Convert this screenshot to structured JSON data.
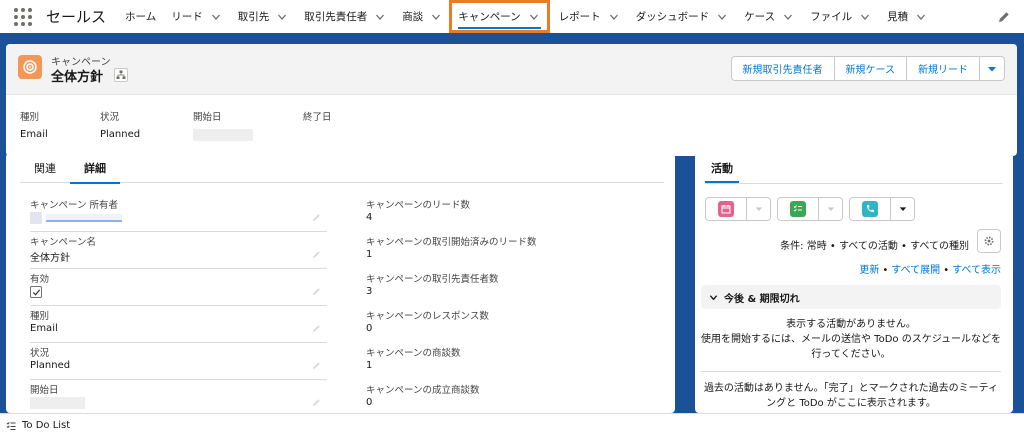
{
  "app": {
    "name": "セールス"
  },
  "nav": {
    "items": [
      {
        "label": "ホーム",
        "has_menu": false
      },
      {
        "label": "リード",
        "has_menu": true
      },
      {
        "label": "取引先",
        "has_menu": true
      },
      {
        "label": "取引先責任者",
        "has_menu": true
      },
      {
        "label": "商談",
        "has_menu": true
      },
      {
        "label": "キャンペーン",
        "has_menu": true,
        "active": true
      },
      {
        "label": "レポート",
        "has_menu": true
      },
      {
        "label": "ダッシュボード",
        "has_menu": true
      },
      {
        "label": "ケース",
        "has_menu": true
      },
      {
        "label": "ファイル",
        "has_menu": true
      },
      {
        "label": "見積",
        "has_menu": true
      }
    ]
  },
  "record": {
    "object_type": "キャンペーン",
    "title": "全体方針",
    "actions": [
      "新規取引先責任者",
      "新規ケース",
      "新規リード"
    ],
    "highlights": [
      {
        "label": "種別",
        "value": "Email"
      },
      {
        "label": "状況",
        "value": "Planned"
      },
      {
        "label": "開始日",
        "value": ""
      },
      {
        "label": "終了日",
        "value": ""
      }
    ]
  },
  "detail": {
    "tabs": [
      "関連",
      "詳細"
    ],
    "active_tab": "詳細",
    "left_fields": [
      {
        "label": "キャンペーン 所有者",
        "value": ""
      },
      {
        "label": "キャンペーン名",
        "value": "全体方針"
      },
      {
        "label": "有効",
        "value": ""
      },
      {
        "label": "種別",
        "value": "Email"
      },
      {
        "label": "状況",
        "value": "Planned"
      },
      {
        "label": "開始日",
        "value": ""
      }
    ],
    "right_fields": [
      {
        "label": "キャンペーンのリード数",
        "value": "4"
      },
      {
        "label": "キャンペーンの取引開始済みのリード数",
        "value": "1"
      },
      {
        "label": "キャンペーンの取引先責任者数",
        "value": "3"
      },
      {
        "label": "キャンペーンのレスポンス数",
        "value": "0"
      },
      {
        "label": "キャンペーンの商談数",
        "value": "1"
      },
      {
        "label": "キャンペーンの成立商談数",
        "value": "0"
      }
    ],
    "active_checked": true
  },
  "activity": {
    "tab": "活動",
    "filter": "条件: 常時 • すべての活動 • すべての種別",
    "links": [
      "更新",
      "すべて展開",
      "すべて表示"
    ],
    "section_title": "今後 & 期限切れ",
    "empty_line1": "表示する活動がありません。",
    "empty_line2": "使用を開始するには、メールの送信や ToDo のスケジュールなどを",
    "empty_line3": "行ってください。",
    "past_line1": "過去の活動はありません。「完了」とマークされた過去のミーティ",
    "past_line2": "ングと ToDo がここに表示されます。"
  },
  "utility": {
    "todo_label": "To Do List"
  },
  "colors": {
    "brand_blue": "#1b5297",
    "accent_orange": "#e57e2b",
    "link_blue": "#0176d3",
    "campaign_orange": "#f49756"
  }
}
